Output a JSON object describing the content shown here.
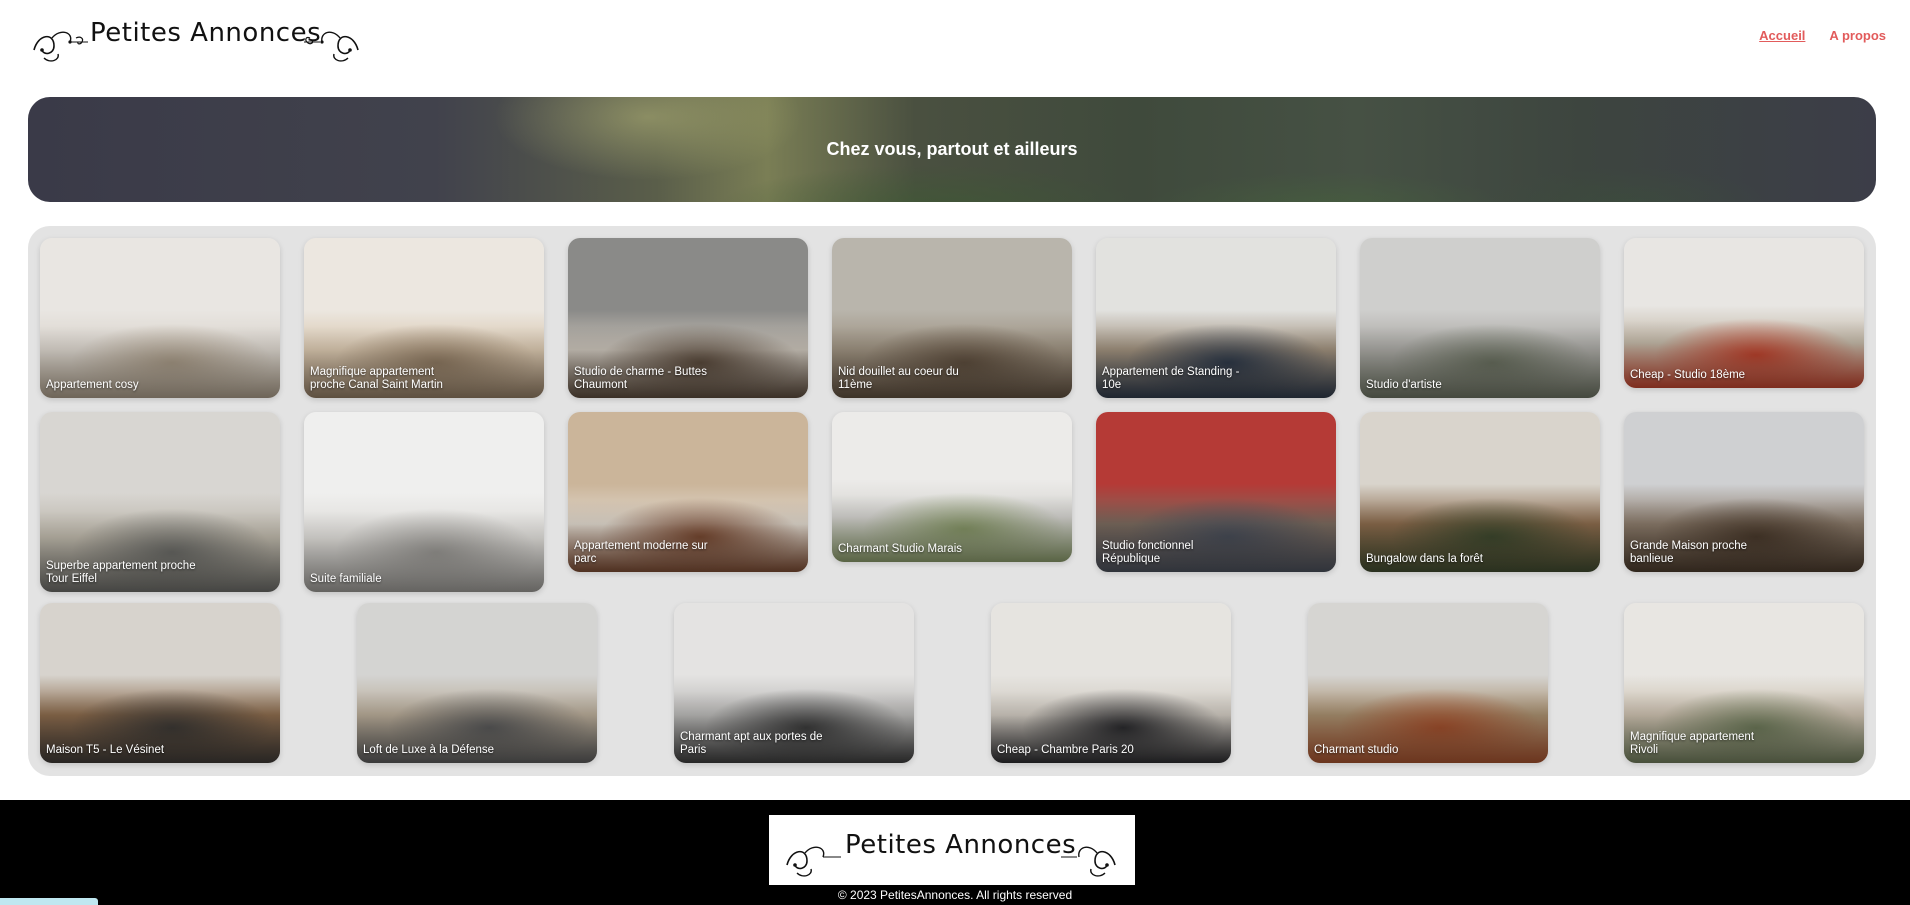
{
  "header": {
    "logo_text": "Petites Annonces",
    "nav": [
      {
        "label": "Accueil",
        "active": true
      },
      {
        "label": "A propos",
        "active": false
      }
    ]
  },
  "hero": {
    "title": "Chez vous, partout et ailleurs"
  },
  "listings": [
    {
      "title": "Appartement cosy",
      "palette": [
        "#e9e6e2",
        "#d9d3cb",
        "#a99b88"
      ]
    },
    {
      "title": "Magnifique appartement proche Canal Saint Martin",
      "palette": [
        "#ece7e0",
        "#d8c6ae",
        "#8f7a62"
      ]
    },
    {
      "title": "Studio de charme - Buttes Chaumont",
      "palette": [
        "#8a8a88",
        "#c9c2b8",
        "#5a4a3c"
      ]
    },
    {
      "title": "Nid douillet au coeur du 11ème",
      "palette": [
        "#b9b5ac",
        "#9c907f",
        "#5e4e3e"
      ]
    },
    {
      "title": "Appartement de Standing - 10e",
      "palette": [
        "#e2e2df",
        "#9e8f7c",
        "#2f3a4a"
      ]
    },
    {
      "title": "Studio d'artiste",
      "palette": [
        "#cfcfcd",
        "#a8a7a2",
        "#6a7060"
      ]
    },
    {
      "title": "Cheap - Studio 18ème",
      "palette": [
        "#e8e6e3",
        "#c4b9a8",
        "#c0442e"
      ]
    },
    {
      "title": "Superbe appartement proche Tour Eiffel",
      "palette": [
        "#d8d6d2",
        "#b9b3a6",
        "#6a6a66"
      ]
    },
    {
      "title": "Suite familiale",
      "palette": [
        "#efefee",
        "#dcdad6",
        "#9a9894"
      ]
    },
    {
      "title": "Appartement moderne sur parc",
      "palette": [
        "#cbb59a",
        "#e0d8cd",
        "#7a4a32"
      ]
    },
    {
      "title": "Charmant Studio Marais",
      "palette": [
        "#ecebe9",
        "#d6d5d1",
        "#8a9a6a"
      ]
    },
    {
      "title": "Studio fonctionnel République",
      "palette": [
        "#b53a36",
        "#7a6a5e",
        "#4a4f5a"
      ]
    },
    {
      "title": "Bungalow dans la forêt",
      "palette": [
        "#d9d4cc",
        "#8a6a4c",
        "#3f4a2f"
      ]
    },
    {
      "title": "Grande Maison proche banlieue",
      "palette": [
        "#cfd0d2",
        "#8a7a6a",
        "#4a3a2c"
      ]
    },
    {
      "title": "Maison T5 - Le Vésinet",
      "palette": [
        "#d7d3cd",
        "#8a6a4c",
        "#3e3a36"
      ]
    },
    {
      "title": "Loft de Luxe à la Défense",
      "palette": [
        "#d4d4d2",
        "#b7aa97",
        "#5a5a5a"
      ]
    },
    {
      "title": "Charmant apt aux portes de Paris",
      "palette": [
        "#e4e3e2",
        "#b9b8b6",
        "#3c3c3c"
      ]
    },
    {
      "title": "Cheap - Chambre Paris 20",
      "palette": [
        "#e6e4e0",
        "#cfc9c0",
        "#2b2b2e"
      ]
    },
    {
      "title": "Charmant studio",
      "palette": [
        "#d6d5d2",
        "#a78e6e",
        "#a4512e"
      ]
    },
    {
      "title": "Magnifique appartement Rivoli",
      "palette": [
        "#e8e6e2",
        "#cbbfae",
        "#6e7a5a"
      ]
    }
  ],
  "footer": {
    "logo_text": "Petites Annonces",
    "copyright": "© 2023 PetitesAnnonces. All rights reserved"
  },
  "colors": {
    "nav_link": "#e25b5b",
    "footer_bg": "#000000",
    "panel_bg": "#e3e3e3"
  },
  "icons": {
    "logo_ornament": "swirl-ornament-icon"
  }
}
